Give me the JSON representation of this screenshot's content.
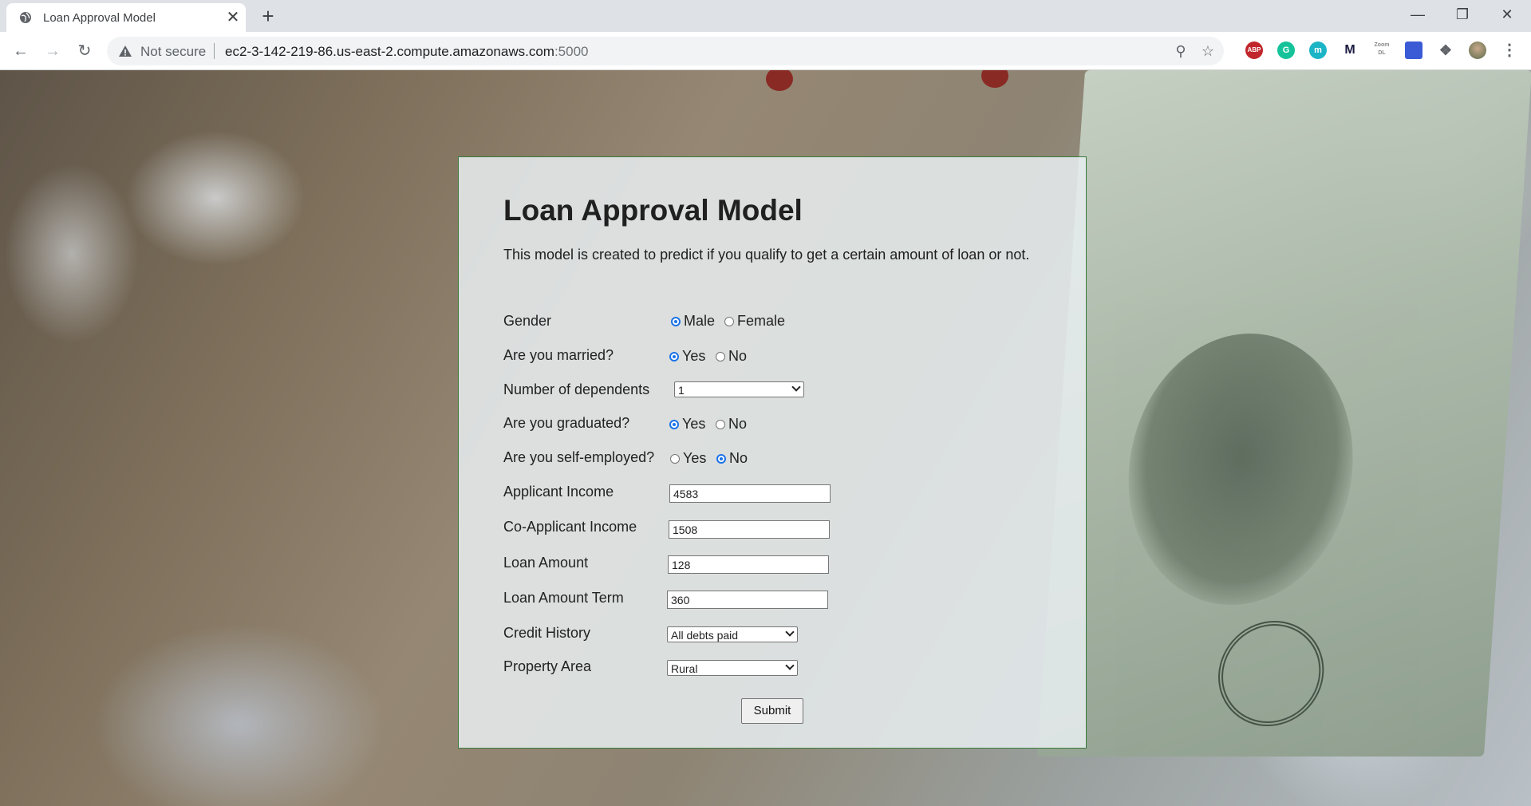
{
  "browser": {
    "tab_title": "Loan Approval Model",
    "close_glyph": "✕",
    "new_tab_glyph": "+",
    "security_text": "Not secure",
    "url_host": "ec2-3-142-219-86.us-east-2.compute.amazonaws.com",
    "url_port": ":5000",
    "extensions": [
      "ABP",
      "G",
      "m",
      "M",
      "Zoom DL"
    ]
  },
  "form": {
    "title": "Loan Approval Model",
    "subtitle": "This model is created to predict if you qualify to get a certain amount of loan or not.",
    "gender": {
      "label": "Gender",
      "options": [
        "Male",
        "Female"
      ],
      "selected": "Male"
    },
    "married": {
      "label": "Are you married?",
      "options": [
        "Yes",
        "No"
      ],
      "selected": "Yes"
    },
    "dependents": {
      "label": "Number of dependents",
      "value": "1"
    },
    "graduated": {
      "label": "Are you graduated?",
      "options": [
        "Yes",
        "No"
      ],
      "selected": "Yes"
    },
    "self_employed": {
      "label": "Are you self-employed?",
      "options": [
        "Yes",
        "No"
      ],
      "selected": "No"
    },
    "applicant_income": {
      "label": "Applicant Income",
      "value": "4583"
    },
    "coapplicant_income": {
      "label": "Co-Applicant Income",
      "value": "1508"
    },
    "loan_amount": {
      "label": "Loan Amount",
      "value": "128"
    },
    "loan_amount_term": {
      "label": "Loan Amount Term",
      "value": "360"
    },
    "credit_history": {
      "label": "Credit History",
      "value": "All debts paid"
    },
    "property_area": {
      "label": "Property Area",
      "value": "Rural"
    },
    "submit_label": "Submit"
  },
  "colors": {
    "card_border": "#3a7a3a",
    "radio_accent": "#1a73e8"
  }
}
